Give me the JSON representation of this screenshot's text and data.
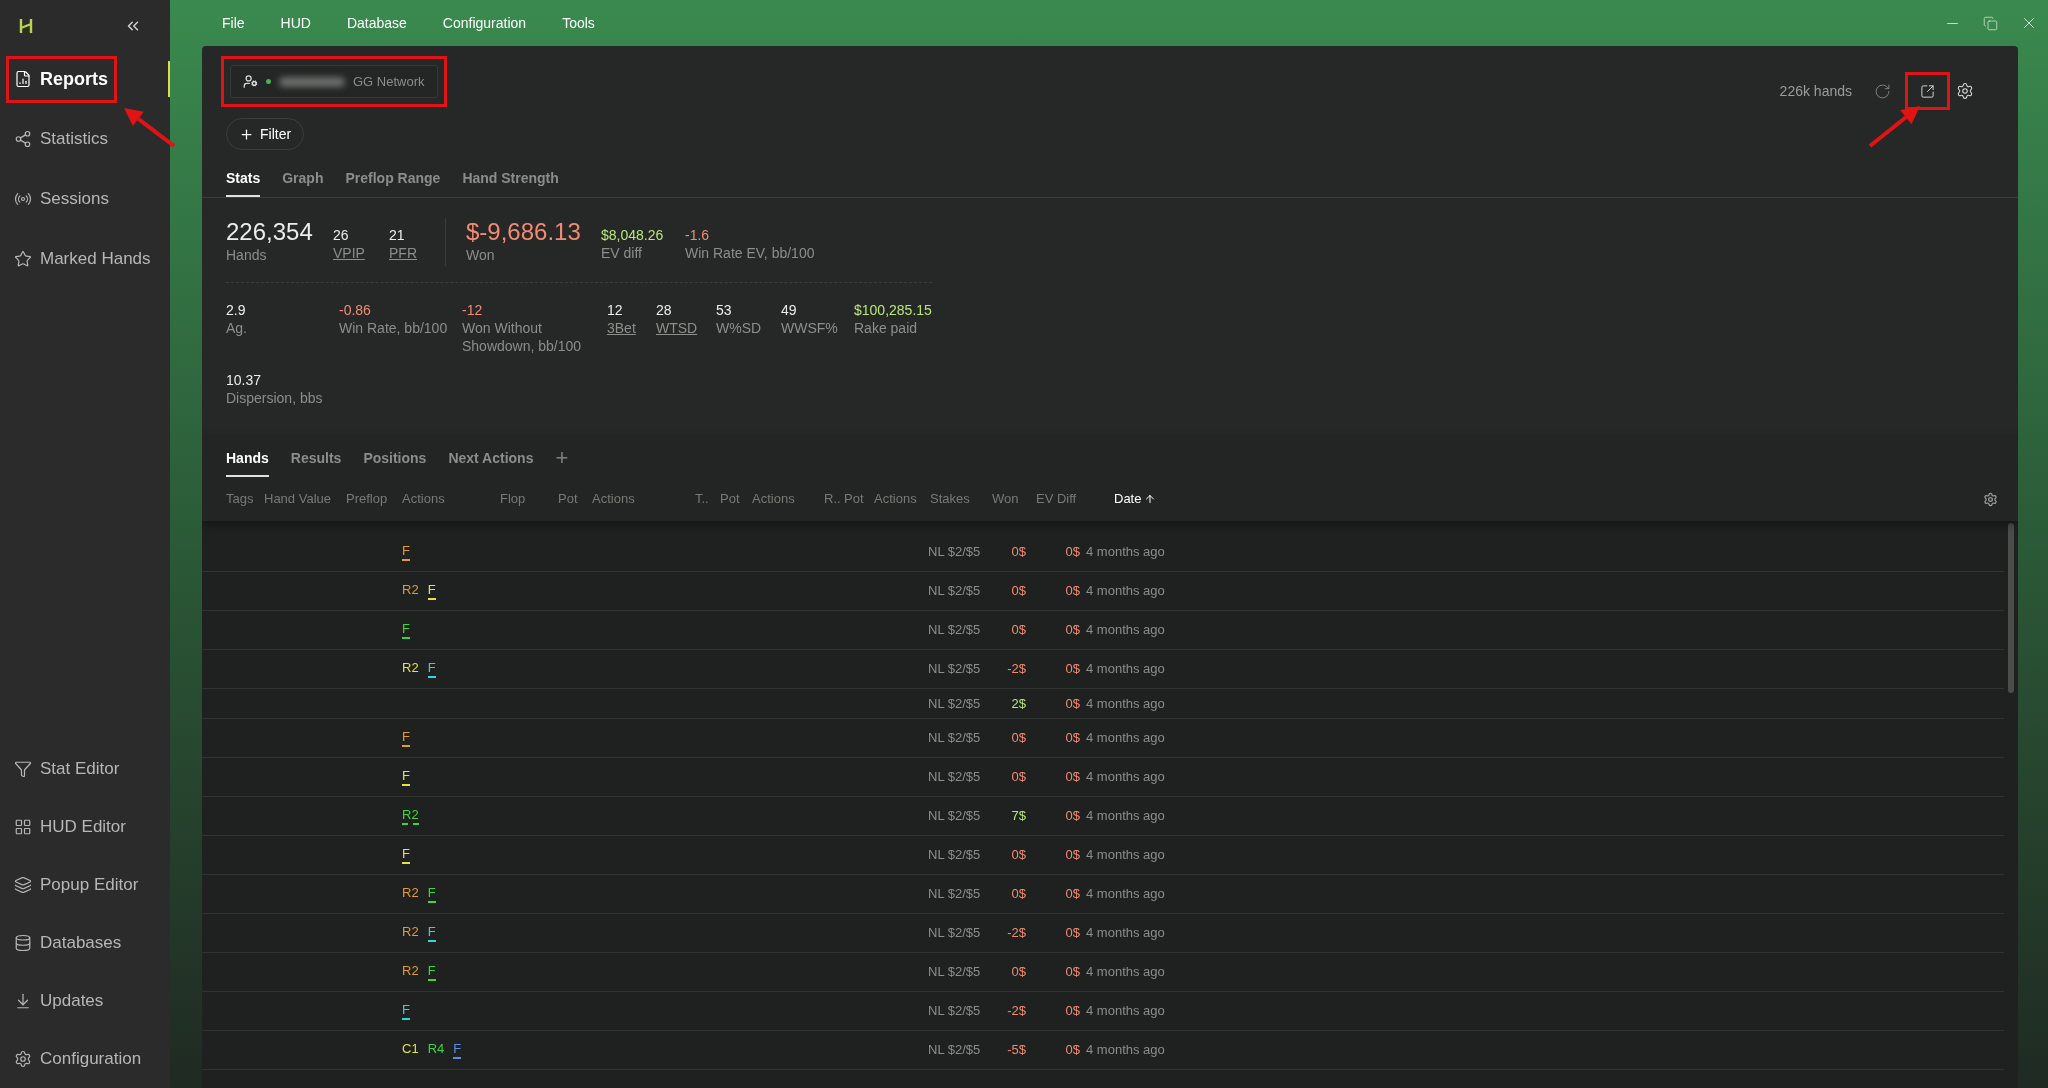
{
  "sidebar": {
    "top_items": [
      {
        "label": "Reports",
        "selected": true,
        "highlighted": true
      },
      {
        "label": "Statistics",
        "selected": false,
        "highlighted": false
      },
      {
        "label": "Sessions",
        "selected": false,
        "highlighted": false
      },
      {
        "label": "Marked Hands",
        "selected": false,
        "highlighted": false
      }
    ],
    "bottom_items": [
      {
        "label": "Stat Editor",
        "selected": false,
        "highlighted": false
      },
      {
        "label": "HUD Editor",
        "selected": false,
        "highlighted": false
      },
      {
        "label": "Popup Editor",
        "selected": false,
        "highlighted": false
      },
      {
        "label": "Databases",
        "selected": false,
        "highlighted": false
      },
      {
        "label": "Updates",
        "selected": false,
        "highlighted": false
      },
      {
        "label": "Configuration",
        "selected": false,
        "highlighted": false
      }
    ]
  },
  "menu": [
    "File",
    "HUD",
    "Database",
    "Configuration",
    "Tools"
  ],
  "account": {
    "network": "GG Network",
    "online": true,
    "highlighted": true
  },
  "filter_button": "Filter",
  "hand_count": "226k hands",
  "export_highlighted": true,
  "report_tabs": [
    {
      "label": "Stats",
      "selected": true
    },
    {
      "label": "Graph",
      "selected": false
    },
    {
      "label": "Preflop Range",
      "selected": false
    },
    {
      "label": "Hand Strength",
      "selected": false
    }
  ],
  "player_stats": [
    {
      "value": "226,354",
      "label": "Hands",
      "color": "#ececec",
      "large": true,
      "link": false
    },
    {
      "value": "26",
      "label": "VPIP",
      "color": "#ececec",
      "large": false,
      "link": true
    },
    {
      "value": "21",
      "label": "PFR",
      "color": "#ececec",
      "large": false,
      "link": true
    }
  ],
  "result_stats": [
    {
      "value": "$-9,686.13",
      "label": "Won",
      "color": "#f28b74",
      "large": true,
      "link": false
    },
    {
      "value": "$8,048.26",
      "label": "EV diff",
      "color": "#b6e57a",
      "large": false,
      "link": false
    },
    {
      "value": "-1.6",
      "label": "Win Rate EV, bb/100",
      "color": "#f28b74",
      "large": false,
      "link": false
    }
  ],
  "detail_stats": [
    {
      "value": "2.9",
      "label": "Ag.",
      "color": "#ececec",
      "link": false
    },
    {
      "value": "-0.86",
      "label": "Win Rate, bb/100",
      "color": "#f28b74",
      "link": false
    },
    {
      "value": "-12",
      "label": "Won Without Showdown, bb/100",
      "color": "#f28b74",
      "link": false
    },
    {
      "value": "12",
      "label": "3Bet",
      "color": "#ececec",
      "link": true
    },
    {
      "value": "28",
      "label": "WTSD",
      "color": "#ececec",
      "link": true
    },
    {
      "value": "53",
      "label": "W%SD",
      "color": "#ececec",
      "link": false
    },
    {
      "value": "49",
      "label": "WWSF%",
      "color": "#ececec",
      "link": false
    },
    {
      "value": "$100,285.15",
      "label": "Rake paid",
      "color": "#b6e57a",
      "link": false
    },
    {
      "value": "10.37",
      "label": "Dispersion, bbs",
      "color": "#ececec",
      "link": false
    }
  ],
  "hands_tabs": [
    {
      "label": "Hands",
      "selected": true
    },
    {
      "label": "Results",
      "selected": false
    },
    {
      "label": "Positions",
      "selected": false
    },
    {
      "label": "Next Actions",
      "selected": false
    }
  ],
  "add_tab": "+",
  "table": {
    "columns": [
      {
        "label": "Tags",
        "sorted": false
      },
      {
        "label": "Hand Value",
        "sorted": false
      },
      {
        "label": "Preflop",
        "sorted": false
      },
      {
        "label": "Actions",
        "sorted": false
      },
      {
        "label": "Flop",
        "sorted": false
      },
      {
        "label": "Pot",
        "sorted": false
      },
      {
        "label": "Actions",
        "sorted": false
      },
      {
        "label": "T..",
        "sorted": false
      },
      {
        "label": "Pot",
        "sorted": false
      },
      {
        "label": "Actions",
        "sorted": false
      },
      {
        "label": "R..",
        "sorted": false
      },
      {
        "label": "Pot",
        "sorted": false
      },
      {
        "label": "Actions",
        "sorted": false
      },
      {
        "label": "Stakes",
        "sorted": false
      },
      {
        "label": "Won",
        "sorted": false
      },
      {
        "label": "EV Diff",
        "sorted": false
      },
      {
        "label": "Date",
        "sorted": true
      }
    ],
    "rows": [
      {
        "actions": [
          {
            "text": "F",
            "color": "#e39a2e",
            "kind": "underlined"
          }
        ],
        "stakes": "NL $2/$5",
        "won": {
          "text": "0$",
          "color": "#f28b74"
        },
        "ev_diff": {
          "text": "0$",
          "color": "#f28b74"
        },
        "date": "4 months ago"
      },
      {
        "actions": [
          {
            "text": "R2",
            "color": "#e39a2e",
            "kind": "plain"
          },
          {
            "text": "F",
            "color": "#e6e040",
            "kind": "underlined"
          }
        ],
        "stakes": "NL $2/$5",
        "won": {
          "text": "0$",
          "color": "#f28b74"
        },
        "ev_diff": {
          "text": "0$",
          "color": "#f28b74"
        },
        "date": "4 months ago"
      },
      {
        "actions": [
          {
            "text": "F",
            "color": "#3fd43f",
            "kind": "underlined"
          }
        ],
        "stakes": "NL $2/$5",
        "won": {
          "text": "0$",
          "color": "#f28b74"
        },
        "ev_diff": {
          "text": "0$",
          "color": "#f28b74"
        },
        "date": "4 months ago"
      },
      {
        "actions": [
          {
            "text": "R2",
            "color": "#e6e040",
            "kind": "plain"
          },
          {
            "text": "F",
            "color": "#2fd6d6",
            "kind": "underlined"
          }
        ],
        "stakes": "NL $2/$5",
        "won": {
          "text": "-2$",
          "color": "#f28b74"
        },
        "ev_diff": {
          "text": "0$",
          "color": "#f28b74"
        },
        "date": "4 months ago"
      },
      {
        "stakes": "NL $2/$5",
        "won": {
          "text": "2$",
          "color": "#b6e57a"
        },
        "ev_diff": {
          "text": "0$",
          "color": "#f28b74"
        },
        "date": "4 months ago"
      },
      {
        "actions": [
          {
            "text": "F",
            "color": "#e39a2e",
            "kind": "underlined"
          }
        ],
        "stakes": "NL $2/$5",
        "won": {
          "text": "0$",
          "color": "#f28b74"
        },
        "ev_diff": {
          "text": "0$",
          "color": "#f28b74"
        },
        "date": "4 months ago"
      },
      {
        "actions": [
          {
            "text": "F",
            "color": "#e6e040",
            "kind": "underlined"
          }
        ],
        "stakes": "NL $2/$5",
        "won": {
          "text": "0$",
          "color": "#f28b74"
        },
        "ev_diff": {
          "text": "0$",
          "color": "#f28b74"
        },
        "date": "4 months ago"
      },
      {
        "actions": [
          {
            "text": "R2",
            "color": "#3fd43f",
            "kind": "dashed"
          }
        ],
        "stakes": "NL $2/$5",
        "won": {
          "text": "7$",
          "color": "#b6e57a"
        },
        "ev_diff": {
          "text": "0$",
          "color": "#f28b74"
        },
        "date": "4 months ago"
      },
      {
        "actions": [
          {
            "text": "F",
            "color": "#e6e040",
            "kind": "underlined"
          }
        ],
        "stakes": "NL $2/$5",
        "won": {
          "text": "0$",
          "color": "#f28b74"
        },
        "ev_diff": {
          "text": "0$",
          "color": "#f28b74"
        },
        "date": "4 months ago"
      },
      {
        "actions": [
          {
            "text": "R2",
            "color": "#e39a2e",
            "kind": "plain"
          },
          {
            "text": "F",
            "color": "#3fd43f",
            "kind": "underlined"
          }
        ],
        "stakes": "NL $2/$5",
        "won": {
          "text": "0$",
          "color": "#f28b74"
        },
        "ev_diff": {
          "text": "0$",
          "color": "#f28b74"
        },
        "date": "4 months ago"
      },
      {
        "actions": [
          {
            "text": "R2",
            "color": "#e39a2e",
            "kind": "plain"
          },
          {
            "text": "F",
            "color": "#2fd6d6",
            "kind": "underlined"
          }
        ],
        "stakes": "NL $2/$5",
        "won": {
          "text": "-2$",
          "color": "#f28b74"
        },
        "ev_diff": {
          "text": "0$",
          "color": "#f28b74"
        },
        "date": "4 months ago"
      },
      {
        "actions": [
          {
            "text": "R2",
            "color": "#e39a2e",
            "kind": "plain"
          },
          {
            "text": "F",
            "color": "#3fd43f",
            "kind": "underlined"
          }
        ],
        "stakes": "NL $2/$5",
        "won": {
          "text": "0$",
          "color": "#f28b74"
        },
        "ev_diff": {
          "text": "0$",
          "color": "#f28b74"
        },
        "date": "4 months ago"
      },
      {
        "actions": [
          {
            "text": "F",
            "color": "#2fd6d6",
            "kind": "underlined"
          }
        ],
        "stakes": "NL $2/$5",
        "won": {
          "text": "-2$",
          "color": "#f28b74"
        },
        "ev_diff": {
          "text": "0$",
          "color": "#f28b74"
        },
        "date": "4 months ago"
      },
      {
        "actions": [
          {
            "text": "C1",
            "color": "#e6e040",
            "kind": "plain"
          },
          {
            "text": "R4",
            "color": "#3fd43f",
            "kind": "plain"
          },
          {
            "text": "F",
            "color": "#5b8de0",
            "kind": "underlined"
          }
        ],
        "stakes": "NL $2/$5",
        "won": {
          "text": "-5$",
          "color": "#f28b74"
        },
        "ev_diff": {
          "text": "0$",
          "color": "#f28b74"
        },
        "date": "4 months ago"
      }
    ]
  }
}
